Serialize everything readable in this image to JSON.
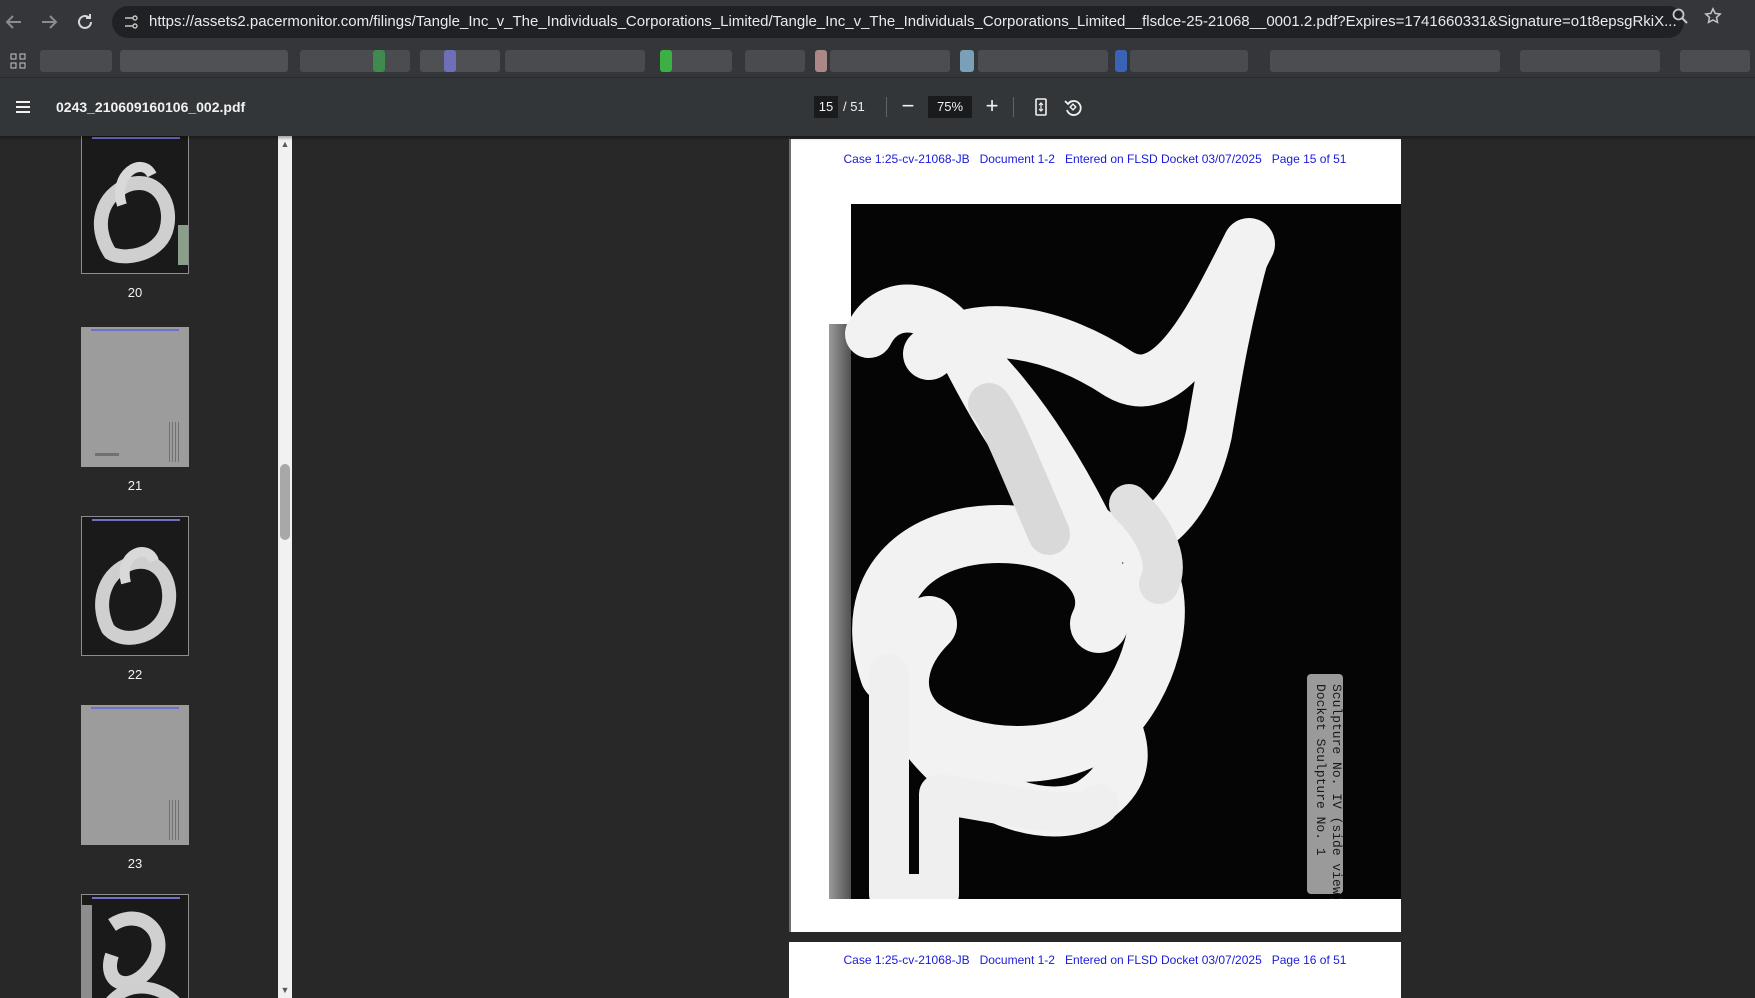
{
  "browser": {
    "url": "https://assets2.pacermonitor.com/filings/Tangle_Inc_v_The_Individuals_Corporations_Limited/Tangle_Inc_v_The_Individuals_Corporations_Limited__flsdce-25-21068__0001.2.pdf?Expires=1741660331&Signature=o1t8epsgRkiX..."
  },
  "toolbar": {
    "file_title": "0243_210609160106_002.pdf",
    "current_page": "15",
    "page_total": "/ 51",
    "zoom": "75%",
    "zoom_out_label": "−",
    "zoom_in_label": "+"
  },
  "sidebar": {
    "thumbnails": [
      {
        "label": "20"
      },
      {
        "label": "21"
      },
      {
        "label": "22"
      },
      {
        "label": "23"
      }
    ]
  },
  "document": {
    "page15_stamp": "Case 1:25-cv-21068-JB   Document 1-2   Entered on FLSD Docket 03/07/2025   Page 15 of 51",
    "page16_stamp": "Case 1:25-cv-21068-JB   Document 1-2   Entered on FLSD Docket 03/07/2025   Page 16 of 51",
    "photo_label_line1": "Docket Sculpture No. 1",
    "photo_label_line2": "Sculpture No. IV (side view)"
  }
}
